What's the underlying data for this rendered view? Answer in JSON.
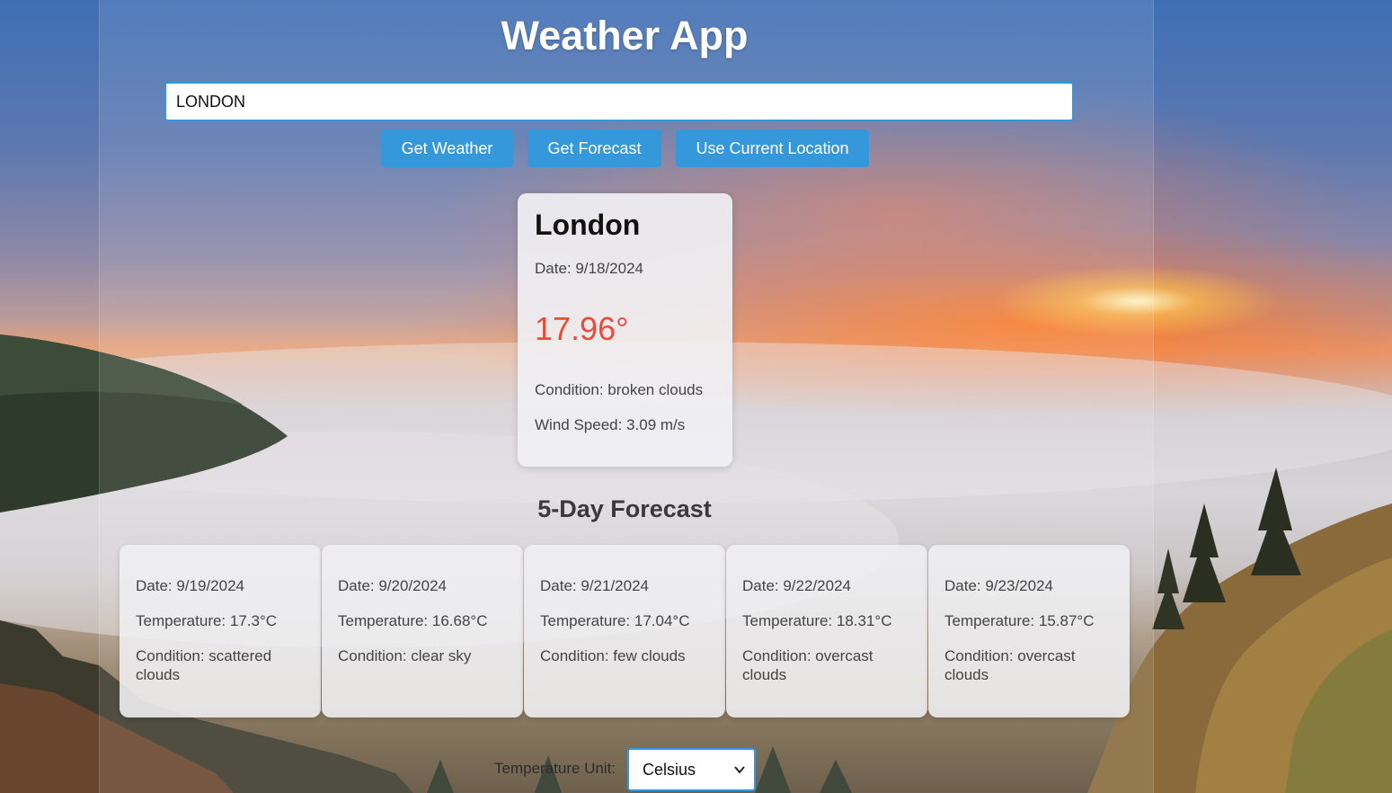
{
  "app": {
    "title": "Weather App"
  },
  "search": {
    "value": "LONDON"
  },
  "buttons": {
    "get_weather": "Get Weather",
    "get_forecast": "Get Forecast",
    "use_location": "Use Current Location"
  },
  "current": {
    "city": "London",
    "date": "Date: 9/18/2024",
    "temperature": "17.96°",
    "condition": "Condition: broken clouds",
    "wind": "Wind Speed: 3.09 m/s"
  },
  "forecast": {
    "title": "5-Day Forecast",
    "days": [
      {
        "date": "Date: 9/19/2024",
        "temperature": "Temperature: 17.3°C",
        "condition": "Condition: scattered clouds"
      },
      {
        "date": "Date: 9/20/2024",
        "temperature": "Temperature: 16.68°C",
        "condition": "Condition: clear sky"
      },
      {
        "date": "Date: 9/21/2024",
        "temperature": "Temperature: 17.04°C",
        "condition": "Condition: few clouds"
      },
      {
        "date": "Date: 9/22/2024",
        "temperature": "Temperature: 18.31°C",
        "condition": "Condition: overcast clouds"
      },
      {
        "date": "Date: 9/23/2024",
        "temperature": "Temperature: 15.87°C",
        "condition": "Condition: overcast clouds"
      }
    ]
  },
  "units": {
    "label": "Temperature Unit:",
    "selected": "Celsius"
  },
  "colors": {
    "accent": "#3498db",
    "temperature": "#e74c3c"
  }
}
